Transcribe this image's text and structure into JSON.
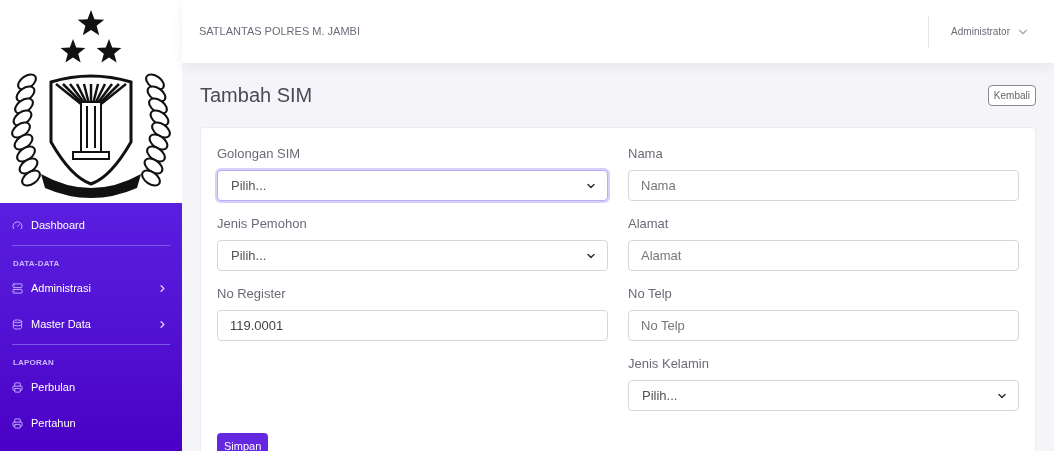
{
  "topbar": {
    "site_title": "SATLANTAS POLRES M. JAMBI",
    "user": "Administrator"
  },
  "sidebar": {
    "sections": [
      {
        "items": [
          {
            "label": "Dashboard",
            "expandable": false
          }
        ]
      },
      {
        "heading": "DATA-DATA",
        "items": [
          {
            "label": "Administrasi",
            "expandable": true
          },
          {
            "label": "Master Data",
            "expandable": true
          }
        ]
      },
      {
        "heading": "LAPORAN",
        "items": [
          {
            "label": "Perbulan",
            "expandable": false
          },
          {
            "label": "Pertahun",
            "expandable": false
          }
        ]
      }
    ]
  },
  "page": {
    "title": "Tambah SIM",
    "back_button": "Kembali"
  },
  "form": {
    "columns": [
      [
        {
          "kind": "select",
          "label": "Golongan SIM",
          "value": "Pilih...",
          "focused": true
        },
        {
          "kind": "select",
          "label": "Jenis Pemohon",
          "value": "Pilih...",
          "focused": false
        },
        {
          "kind": "input",
          "label": "No Register",
          "value": "119.0001",
          "focused": false
        }
      ],
      [
        {
          "kind": "input",
          "label": "Nama",
          "placeholder": "Nama",
          "focused": false
        },
        {
          "kind": "input",
          "label": "Alamat",
          "placeholder": "Alamat",
          "focused": false
        },
        {
          "kind": "input",
          "label": "No Telp",
          "placeholder": "No Telp",
          "focused": false
        },
        {
          "kind": "select",
          "label": "Jenis Kelamin",
          "value": "Pilih...",
          "focused": false
        }
      ]
    ],
    "submit": "Simpan"
  }
}
